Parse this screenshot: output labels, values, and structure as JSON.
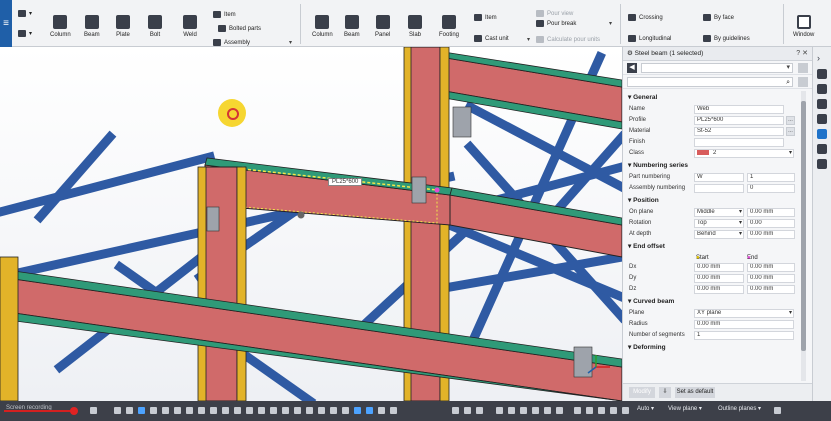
{
  "ribbon": {
    "app_menu_icon": "hamburger-icon",
    "groups": {
      "steel": {
        "column": "Column",
        "beam": "Beam",
        "plate": "Plate",
        "bolt": "Bolt",
        "weld": "Weld"
      },
      "parts": {
        "item": "Item",
        "bolted_parts": "Bolted parts",
        "assembly": "Assembly"
      },
      "concrete": {
        "column": "Column",
        "beam": "Beam",
        "panel": "Panel",
        "slab": "Slab",
        "footing": "Footing",
        "item": "Item",
        "cast_unit": "Cast unit"
      },
      "pour": {
        "pour_view": "Pour view",
        "pour_break": "Pour break",
        "calculate": "Calculate pour units"
      },
      "rebar": {
        "crossing": "Crossing",
        "by_face": "By face",
        "longitudinal": "Longitudinal",
        "by_guidelines": "By guidelines"
      },
      "window": "Window"
    }
  },
  "viewport": {
    "beam_tag": "PL25*600"
  },
  "panel": {
    "title": "Steel beam (1 selected)",
    "sections": {
      "general": "General",
      "numbering": "Numbering series",
      "position": "Position",
      "end_offset": "End offset",
      "curved": "Curved beam",
      "deforming": "Deforming"
    },
    "general": {
      "name_label": "Name",
      "name_value": "Web",
      "profile_label": "Profile",
      "profile_value": "PL25*600",
      "material_label": "Material",
      "material_value": "St-52",
      "finish_label": "Finish",
      "finish_value": "",
      "class_label": "Class",
      "class_value": "2"
    },
    "numbering": {
      "part_label": "Part numbering",
      "part_prefix": "W",
      "part_start": "1",
      "assembly_label": "Assembly numbering",
      "assembly_prefix": "",
      "assembly_start": "0"
    },
    "position": {
      "on_plane_label": "On plane",
      "on_plane_value": "Middle",
      "on_plane_offset": "0.00 mm",
      "rotation_label": "Rotation",
      "rotation_value": "Top",
      "rotation_offset": "0.00",
      "at_depth_label": "At depth",
      "at_depth_value": "Behind",
      "at_depth_offset": "0.00 mm"
    },
    "end_offset": {
      "start_label": "Start",
      "end_label": "End",
      "dx_label": "Dx",
      "dx_start": "0.00 mm",
      "dx_end": "0.00 mm",
      "dy_label": "Dy",
      "dy_start": "0.00 mm",
      "dy_end": "0.00 mm",
      "dz_label": "Dz",
      "dz_start": "0.00 mm",
      "dz_end": "0.00 mm"
    },
    "curved": {
      "plane_label": "Plane",
      "plane_value": "XY plane",
      "radius_label": "Radius",
      "radius_value": "0.00 mm",
      "segments_label": "Number of segments",
      "segments_value": "1"
    },
    "footer": {
      "modify": "Modify",
      "set_default": "Set as default"
    }
  },
  "statusbar": {
    "left_text": "Screen recording",
    "auto": "Auto ▾",
    "view_plane": "View plane ▾",
    "outline_planes": "Outline planes ▾"
  },
  "colors": {
    "ribbon_bg": "#f2f3f5",
    "accent": "#1f5fa8",
    "steel_red": "#d06a6a",
    "steel_blue": "#2f5aa3",
    "steel_green": "#2f9a78",
    "steel_yellow": "#e2b329",
    "status_bg": "#3d4049"
  }
}
